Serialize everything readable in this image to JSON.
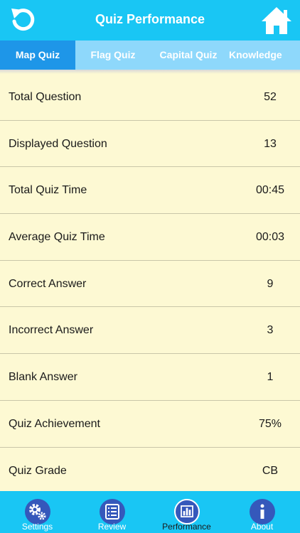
{
  "header": {
    "title": "Quiz Performance"
  },
  "tabs": [
    {
      "label": "Map Quiz",
      "active": true
    },
    {
      "label": "Flag Quiz",
      "active": false
    },
    {
      "label": "Capital Quiz",
      "active": false
    },
    {
      "label": "Knowledge",
      "active": false
    }
  ],
  "stats": [
    {
      "label": "Total Question",
      "value": "52"
    },
    {
      "label": "Displayed Question",
      "value": "13"
    },
    {
      "label": "Total Quiz Time",
      "value": "00:45"
    },
    {
      "label": "Average Quiz Time",
      "value": "00:03"
    },
    {
      "label": "Correct Answer",
      "value": "9"
    },
    {
      "label": "Incorrect Answer",
      "value": "3"
    },
    {
      "label": "Blank Answer",
      "value": "1"
    },
    {
      "label": "Quiz Achievement",
      "value": "75%"
    },
    {
      "label": "Quiz Grade",
      "value": "CB"
    }
  ],
  "bottom_nav": [
    {
      "label": "Settings",
      "icon": "gears-icon"
    },
    {
      "label": "Review",
      "icon": "list-icon"
    },
    {
      "label": "Performance",
      "icon": "bar-chart-icon",
      "active": true
    },
    {
      "label": "About",
      "icon": "info-icon"
    }
  ],
  "colors": {
    "header": "#19c6f4",
    "tab_active": "#1e96e8",
    "tab_inactive": "#8ed8fb",
    "background": "#fdf9d3",
    "nav_circle": "#3558bb"
  }
}
